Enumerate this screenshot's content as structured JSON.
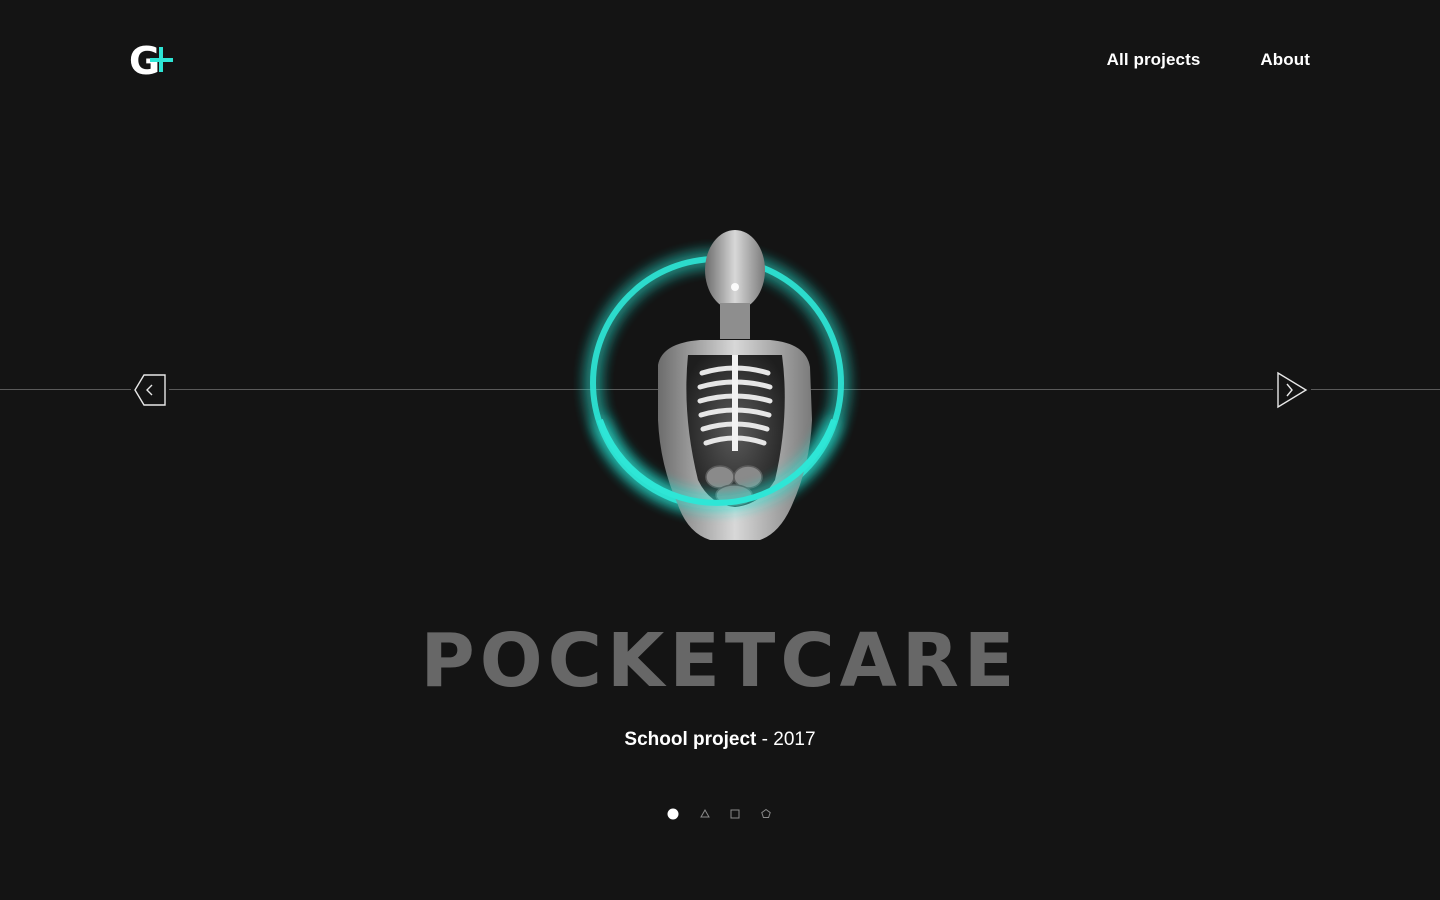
{
  "header": {
    "logo_letter": "G",
    "nav": [
      {
        "label": "All projects"
      },
      {
        "label": "About"
      }
    ]
  },
  "slider": {
    "title": "POCKETCARE",
    "subtitle_strong": "School project",
    "subtitle_separator": " - ",
    "subtitle_year": "2017",
    "prev_icon": "pentagon-chevron-left-icon",
    "next_icon": "triangle-chevron-right-icon",
    "pagination": [
      {
        "shape": "circle",
        "active": true
      },
      {
        "shape": "triangle",
        "active": false
      },
      {
        "shape": "square",
        "active": false
      },
      {
        "shape": "pentagon",
        "active": false
      }
    ]
  },
  "colors": {
    "background": "#141414",
    "accent": "#2ee6d6",
    "title": "#676767",
    "text": "#ffffff"
  }
}
